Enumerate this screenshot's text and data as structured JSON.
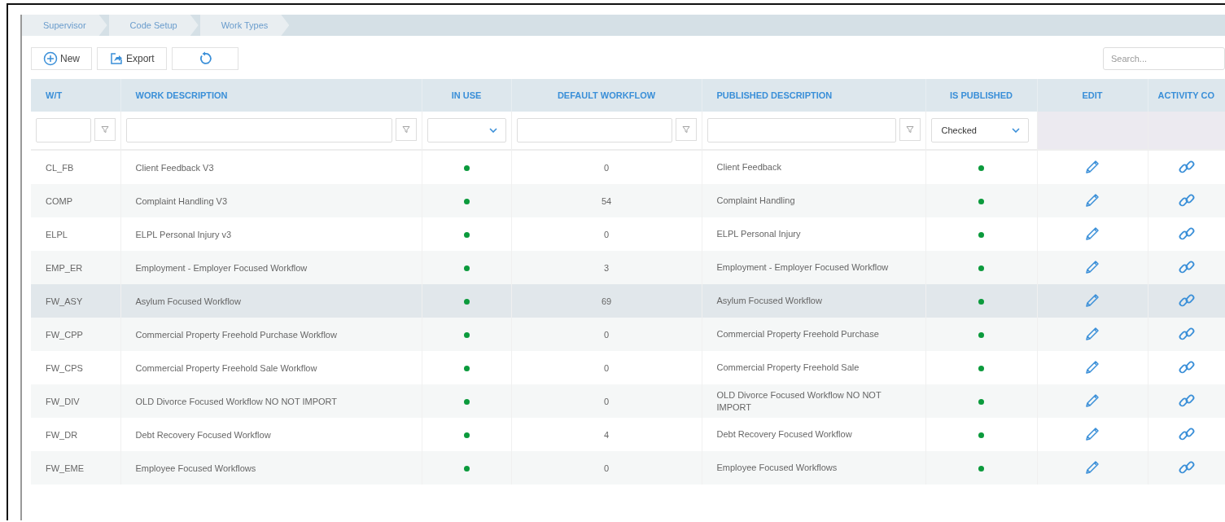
{
  "breadcrumb": [
    "Supervisor",
    "Code Setup",
    "Work Types"
  ],
  "toolbar": {
    "buttons": [
      {
        "kind": "new",
        "label": "New"
      },
      {
        "kind": "export",
        "label": "Export"
      },
      {
        "kind": "refresh"
      }
    ],
    "search": {
      "placeholder": "Search..."
    }
  },
  "table": {
    "columns": [
      "W/T",
      "WORK DESCRIPTION",
      "IN USE",
      "DEFAULT WORKFLOW",
      "PUBLISHED DESCRIPTION",
      "IS PUBLISHED",
      "EDIT",
      "ACTIVITY CO"
    ],
    "filters": [
      {
        "kind": "text"
      },
      {
        "kind": "text"
      },
      {
        "kind": "select"
      },
      {
        "kind": "text"
      },
      {
        "kind": "text"
      },
      {
        "kind": "select",
        "value": "Checked"
      },
      {
        "kind": "none"
      },
      {
        "kind": "none"
      }
    ],
    "rows": [
      {
        "wt": "CL_FB",
        "description": "Client Feedback V3",
        "in_use": true,
        "default_workflow": "0",
        "published_description": "Client Feedback",
        "is_published": true,
        "selected": false
      },
      {
        "wt": "COMP",
        "description": "Complaint Handling V3",
        "in_use": true,
        "default_workflow": "54",
        "published_description": "Complaint Handling",
        "is_published": true,
        "selected": false
      },
      {
        "wt": "ELPL",
        "description": "ELPL Personal Injury v3",
        "in_use": true,
        "default_workflow": "0",
        "published_description": "ELPL Personal Injury",
        "is_published": true,
        "selected": false
      },
      {
        "wt": "EMP_ER",
        "description": "Employment - Employer Focused Workflow",
        "in_use": true,
        "default_workflow": "3",
        "published_description": "Employment - Employer Focused Workflow",
        "is_published": true,
        "selected": false
      },
      {
        "wt": "FW_ASY",
        "description": "Asylum Focused Workflow",
        "in_use": true,
        "default_workflow": "69",
        "published_description": "Asylum Focused Workflow",
        "is_published": true,
        "selected": true
      },
      {
        "wt": "FW_CPP",
        "description": "Commercial Property Freehold Purchase Workflow",
        "in_use": true,
        "default_workflow": "0",
        "published_description": "Commercial Property Freehold Purchase",
        "is_published": true,
        "selected": false
      },
      {
        "wt": "FW_CPS",
        "description": "Commercial Property Freehold Sale Workflow",
        "in_use": true,
        "default_workflow": "0",
        "published_description": "Commercial Property Freehold Sale",
        "is_published": true,
        "selected": false
      },
      {
        "wt": "FW_DIV",
        "description": "OLD Divorce Focused Workflow NO NOT IMPORT",
        "in_use": true,
        "default_workflow": "0",
        "published_description": "OLD Divorce Focused Workflow NO NOT IMPORT",
        "is_published": true,
        "selected": false
      },
      {
        "wt": "FW_DR",
        "description": "Debt Recovery Focused Workflow",
        "in_use": true,
        "default_workflow": "4",
        "published_description": "Debt Recovery Focused Workflow",
        "is_published": true,
        "selected": false
      },
      {
        "wt": "FW_EME",
        "description": "Employee Focused Workflows",
        "in_use": true,
        "default_workflow": "0",
        "published_description": "Employee Focused Workflows",
        "is_published": true,
        "selected": false
      }
    ]
  }
}
